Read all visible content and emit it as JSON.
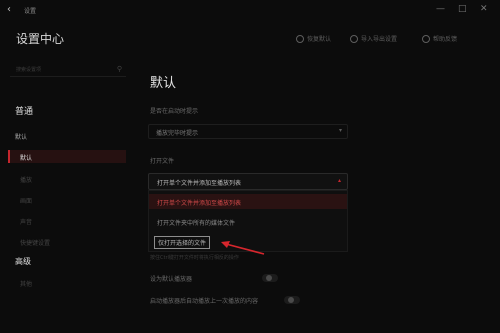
{
  "titlebar": {
    "back_icon": "back-arrow-icon",
    "app_title": "设置",
    "controls": [
      "minimize-icon",
      "maximize-icon",
      "close-icon"
    ]
  },
  "header": {
    "title": "设置中心",
    "actions": [
      {
        "label": "恢复默认",
        "icon": "refresh-icon"
      },
      {
        "label": "导入导出设置",
        "icon": "import-export-icon"
      },
      {
        "label": "帮助反馈",
        "icon": "help-icon"
      }
    ]
  },
  "sidebar": {
    "search_placeholder": "搜索设置项",
    "group_general": "普通",
    "subgroup": "默认",
    "items": [
      {
        "label": "默认",
        "selected": true
      },
      {
        "label": "播放"
      },
      {
        "label": "画面"
      },
      {
        "label": "声音"
      },
      {
        "label": "快捷键设置"
      }
    ],
    "group_advanced": "高级",
    "advanced_items": [
      {
        "label": "其他"
      }
    ]
  },
  "main": {
    "title": "默认",
    "section_open_hint": "是否在启动时提示",
    "dropdown1_value": "播放完毕时提示",
    "section_open_file": "打开文件",
    "dropdown2_value": "打开单个文件并添加至播放列表",
    "options": [
      "打开单个文件并添加至播放列表",
      "打开文件夹中所有的媒体文件",
      "仅打开选择的文件"
    ],
    "tip": "按住Ctrl键打开文件时将执行相反的操作",
    "setting1_label": "设为默认播放器",
    "setting2_label": "启动播放器后自动播放上一次播放的内容"
  },
  "colors": {
    "accent": "#c5262d",
    "background": "#0c0c0c",
    "highlight_bg": "#2a1212"
  }
}
